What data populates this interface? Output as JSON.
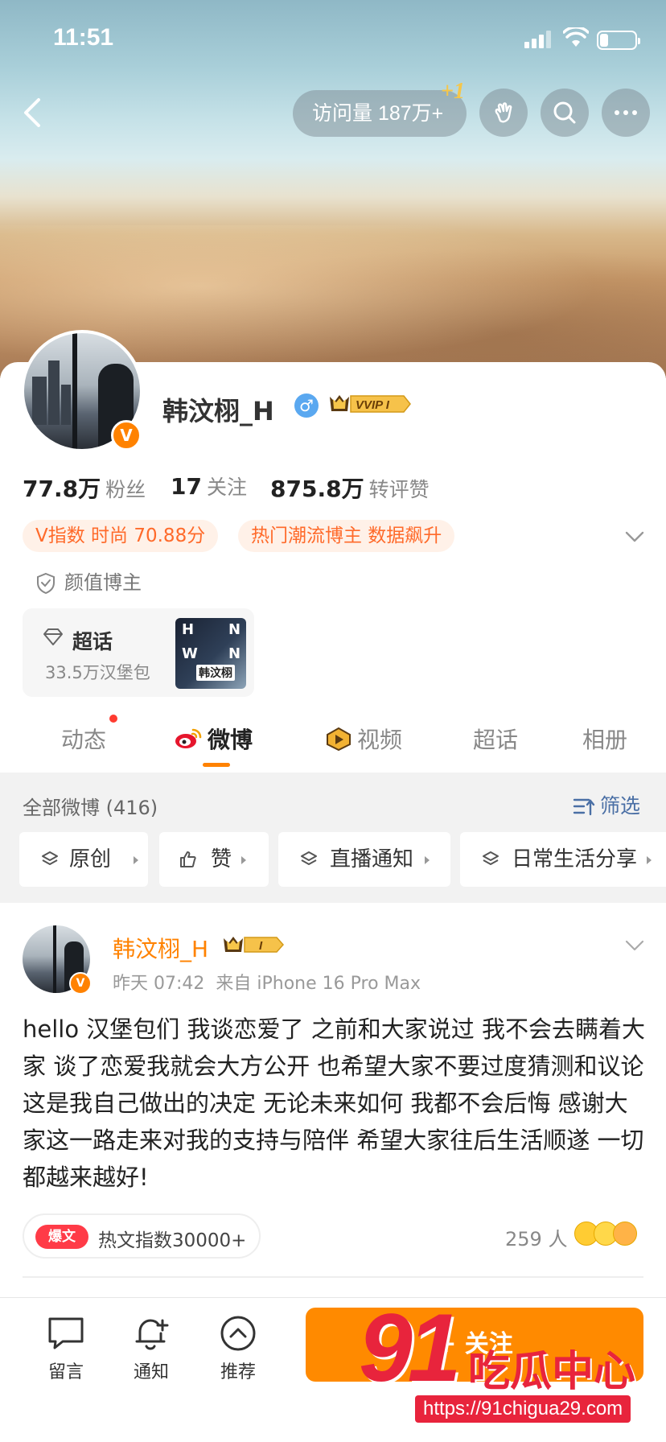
{
  "status_bar": {
    "time": "11:51"
  },
  "header": {
    "visit_label": "访问量 187万+",
    "visit_badge": "+1"
  },
  "profile": {
    "name": "韩汶栩_H",
    "gender_symbol": "♂",
    "vip_label": "VVIP I",
    "verified_badge": "V",
    "stats": [
      {
        "value": "77.8万",
        "label": "粉丝"
      },
      {
        "value": "17",
        "label": "关注"
      },
      {
        "value": "875.8万",
        "label": "转评赞"
      }
    ],
    "tags": [
      "V指数 时尚 70.88分",
      "热门潮流博主 数据飙升"
    ],
    "identity": "颜值博主",
    "chaohua": {
      "title": "超话",
      "subtitle": "33.5万汉堡包",
      "thumb_letters": [
        "H",
        "N",
        "W",
        "N"
      ],
      "thumb_name": "韩汶栩"
    }
  },
  "tabs": [
    {
      "label": "动态",
      "active": false
    },
    {
      "label": "微博",
      "active": true
    },
    {
      "label": "视频",
      "active": false
    },
    {
      "label": "超话",
      "active": false
    },
    {
      "label": "相册",
      "active": false
    }
  ],
  "feed_filter": {
    "all_label": "全部微博 (416)",
    "filter_label": "筛选",
    "chips": [
      "原创",
      "赞",
      "直播通知",
      "日常生活分享"
    ]
  },
  "post": {
    "author": "韩汶栩_H",
    "vip_level": "I",
    "verified_badge": "V",
    "time": "昨天 07:42",
    "source": "来自 iPhone 16 Pro Max",
    "text": "hello 汉堡包们 我谈恋爱了 之前和大家说过 我不会去瞒着大家 谈了恋爱我就会大方公开 也希望大家不要过度猜测和议论 这是我自己做出的决定 无论未来如何 我都不会后悔 感谢大家这一路走来对我的支持与陪伴 希望大家往后生活顺遂 一切都越来越好!",
    "hot_badge": "爆文",
    "hot_text": "热文指数30000+",
    "reactions_count": "259 人"
  },
  "bottom_bar": {
    "items": [
      {
        "label": "留言",
        "icon": "message-icon"
      },
      {
        "label": "通知",
        "icon": "bell-plus-icon"
      },
      {
        "label": "推荐",
        "icon": "chevron-up-circle-icon"
      }
    ],
    "follow_label": "+ 关注"
  },
  "watermark": {
    "big": "91",
    "text": "吃瓜中心",
    "url": "https://91chigua29.com"
  },
  "colors": {
    "accent": "#ff8200",
    "link_blue": "#4a6fa5",
    "watermark_red": "#e8243c",
    "tag_bg": "#fff1e8",
    "tag_text": "#ff6a2a"
  }
}
